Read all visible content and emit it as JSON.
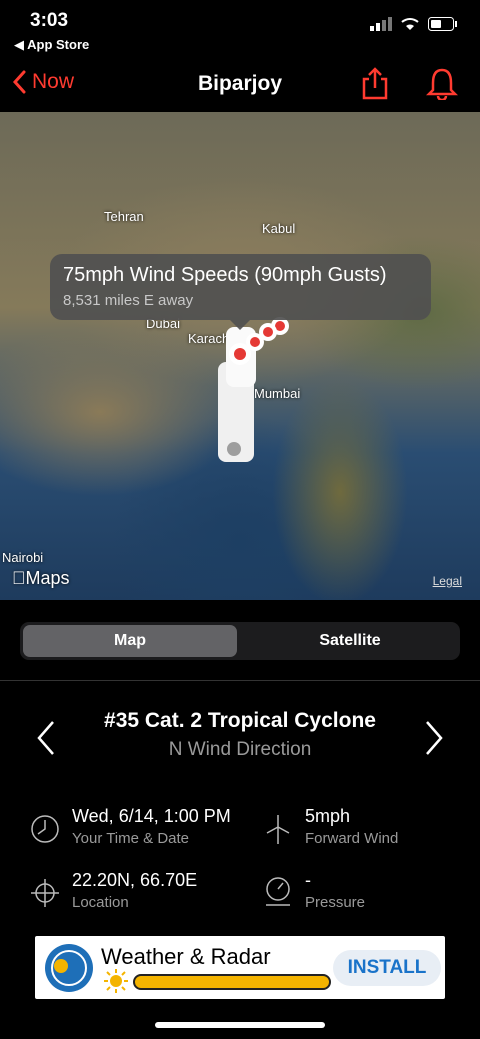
{
  "status_bar": {
    "time": "3:03",
    "back_app": "◀ App Store"
  },
  "nav": {
    "back_label": "Now",
    "title": "Biparjoy"
  },
  "map": {
    "cities": [
      "Tehran",
      "Kabul",
      "Dubai",
      "Karachi",
      "Mumbai",
      "Nairobi"
    ],
    "callout_title": "75mph Wind Speeds (90mph Gusts)",
    "callout_subtitle": "8,531 miles E away",
    "logo": "Maps",
    "legal": "Legal"
  },
  "map_type": {
    "options": [
      "Map",
      "Satellite"
    ],
    "selected": "Map"
  },
  "storm": {
    "title": "#35 Cat. 2 Tropical Cyclone",
    "subtitle": "N Wind Direction"
  },
  "details": {
    "time_value": "Wed, 6/14, 1:00 PM",
    "time_label": "Your Time & Date",
    "wind_value": "5mph",
    "wind_label": "Forward Wind",
    "location_value": "22.20N, 66.70E",
    "location_label": "Location",
    "pressure_value": "-",
    "pressure_label": "Pressure"
  },
  "ad": {
    "name": "Weather & Radar",
    "cta": "INSTALL"
  },
  "colors": {
    "accent": "#ff3b30",
    "track": "#e53935",
    "ad_cta": "#1a73c9"
  }
}
